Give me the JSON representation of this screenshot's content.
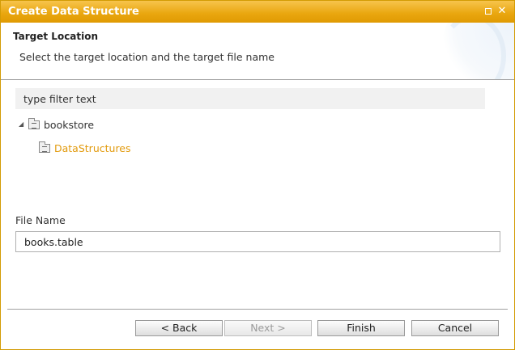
{
  "window": {
    "title": "Create Data Structure",
    "controls": {
      "maximize_icon": "maximize-icon",
      "close_icon": "close-icon",
      "close_glyph": "✕"
    }
  },
  "header": {
    "title": "Target Location",
    "description": "Select the target location and the target file name"
  },
  "filter": {
    "placeholder": "type filter text",
    "value": ""
  },
  "tree": {
    "items": [
      {
        "label": "bookstore",
        "expanded": true,
        "selected": false,
        "icon": "folder-icon"
      },
      {
        "label": "DataStructures",
        "selected": true,
        "icon": "folder-icon"
      }
    ],
    "expanded_glyph": "◢"
  },
  "file_name": {
    "label": "File Name",
    "value": "books.table"
  },
  "buttons": {
    "back": "< Back",
    "next": "Next >",
    "finish": "Finish",
    "cancel": "Cancel"
  },
  "colors": {
    "accent": "#e9a60e",
    "selected_text": "#e29a0c"
  }
}
